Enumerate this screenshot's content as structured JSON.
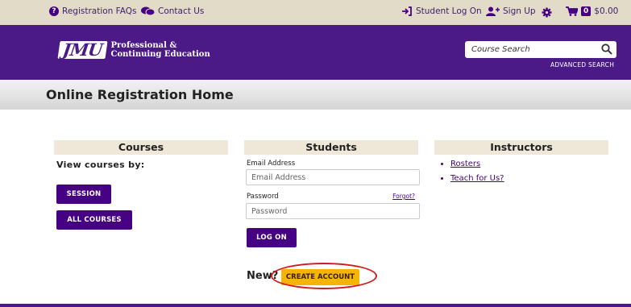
{
  "topbar": {
    "faq_label": "Registration FAQs",
    "contact_label": "Contact Us",
    "login_label": "Student Log On",
    "signup_label": "Sign Up",
    "cart_count": "0",
    "cart_total": "$0.00"
  },
  "header": {
    "logo_mark": "JMU",
    "logo_line1": "Professional &",
    "logo_line2": "Continuing Education",
    "search_placeholder": "Course Search",
    "advanced_search": "ADVANCED SEARCH"
  },
  "page": {
    "title": "Online Registration Home"
  },
  "courses": {
    "heading": "Courses",
    "view_by": "View courses by:",
    "session_button": "SESSION",
    "all_courses_button": "ALL COURSES"
  },
  "students": {
    "heading": "Students",
    "email_label": "Email Address",
    "email_placeholder": "Email Address",
    "password_label": "Password",
    "forgot_label": "Forgot?",
    "password_placeholder": "Password",
    "logon_button": "LOG ON",
    "new_label": "New?",
    "create_account_button": "CREATE ACCOUNT"
  },
  "instructors": {
    "heading": "Instructors",
    "links": [
      "Rosters",
      "Teach for Us?"
    ]
  },
  "colors": {
    "brand_purple": "#4b1a86",
    "gold": "#f5b400",
    "topbar_beige": "#e2dbc8",
    "highlight_red": "#d11a1a"
  }
}
